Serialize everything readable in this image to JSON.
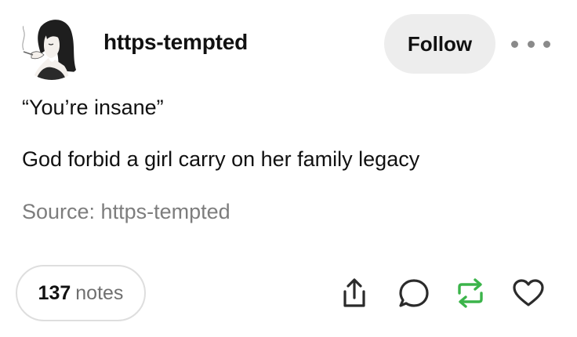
{
  "post": {
    "username": "https-tempted",
    "follow_label": "Follow",
    "body_lines": [
      "“You’re insane”",
      "God forbid a girl carry on her family legacy"
    ],
    "source_label": "Source: https-tempted",
    "notes_count": "137",
    "notes_label": "notes"
  },
  "icons": {
    "avatar": "avatar-illustration",
    "more": "more-options-icon",
    "share": "share-icon",
    "reply": "reply-icon",
    "reblog": "reblog-icon",
    "like": "heart-icon"
  },
  "colors": {
    "follow_bg": "#ededed",
    "source_text": "#7d7d7d",
    "reblog_green": "#3bb44a",
    "icon_dark": "#2b2b2b"
  }
}
